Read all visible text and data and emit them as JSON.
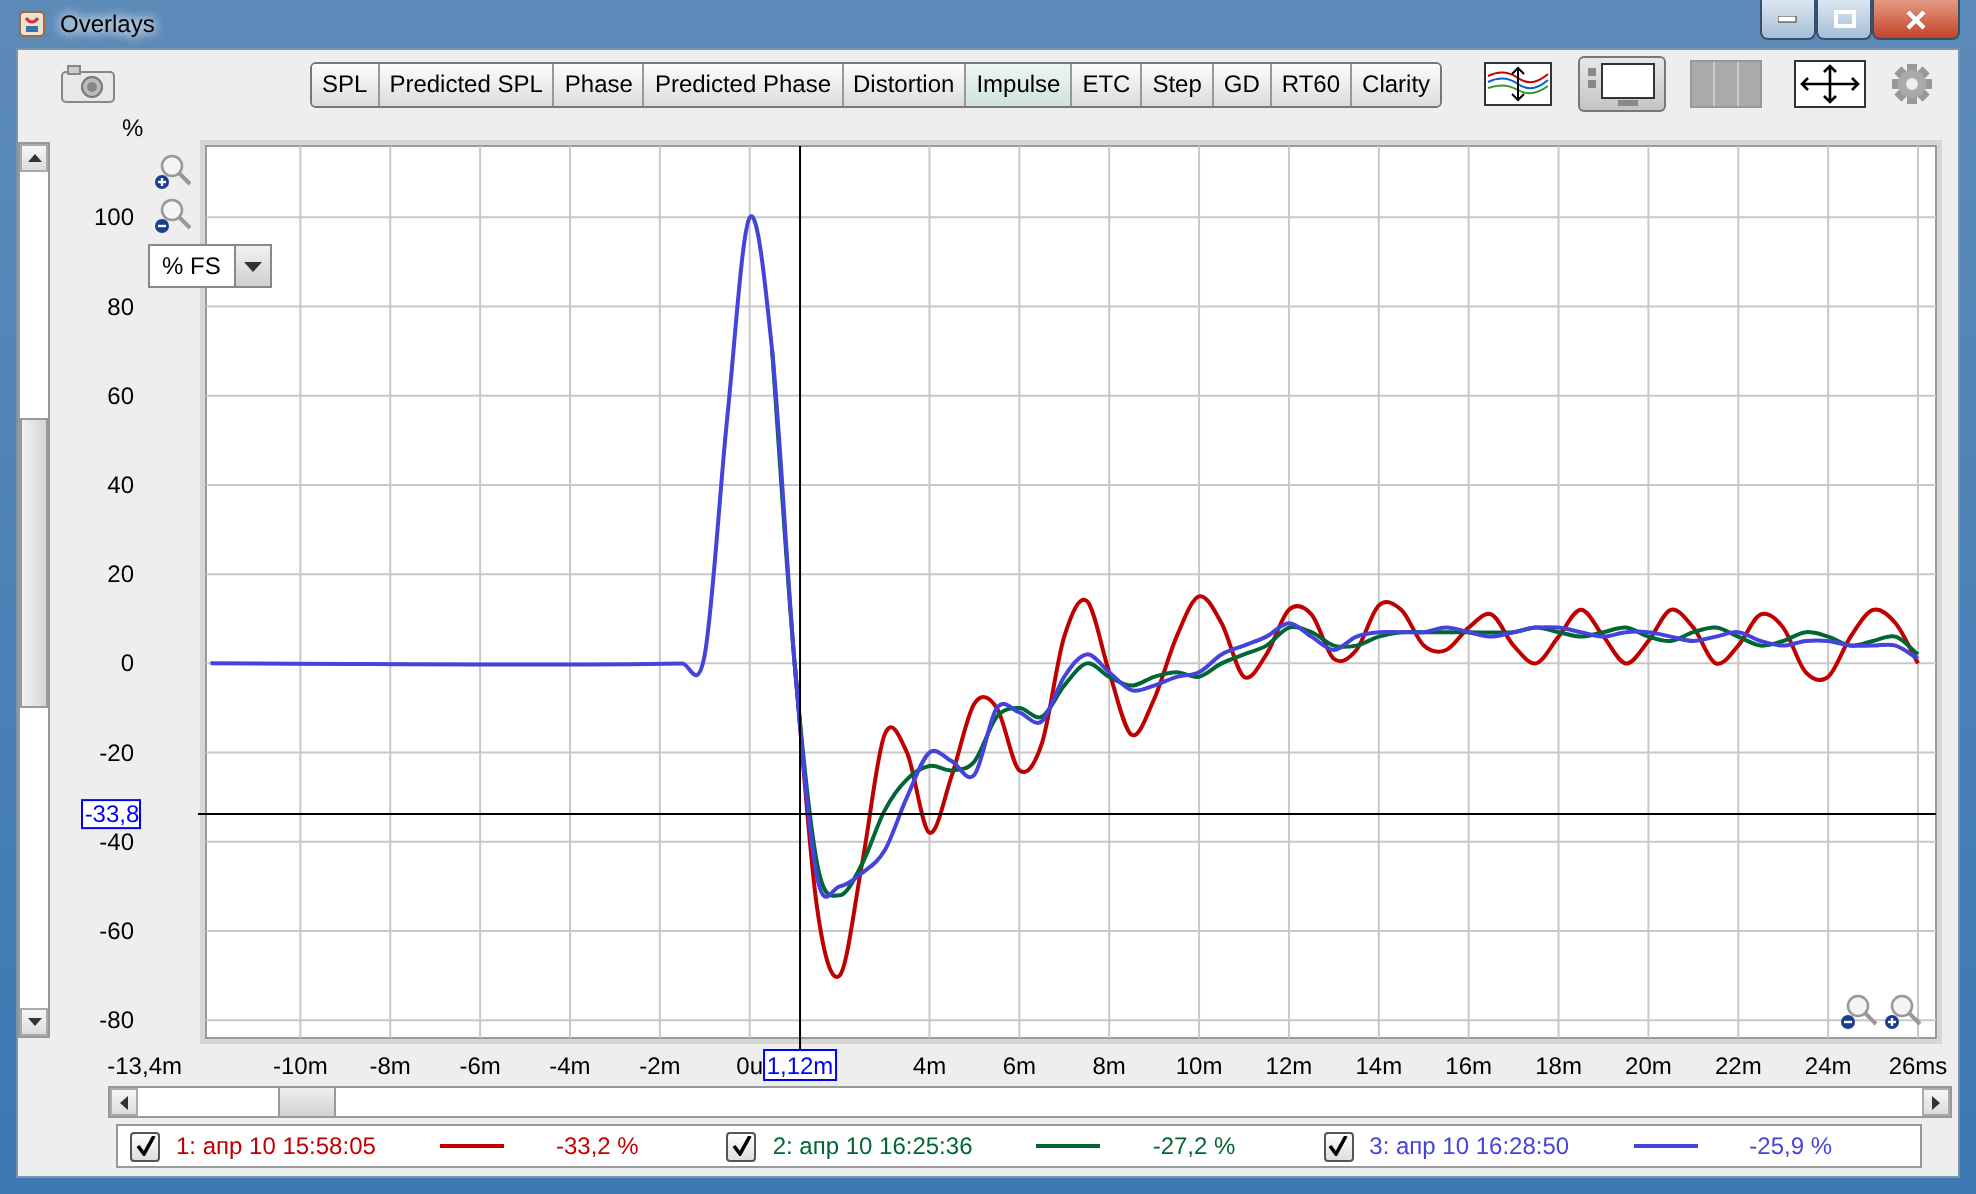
{
  "window": {
    "title": "Overlays"
  },
  "tabs": [
    {
      "label": "SPL",
      "selected": false
    },
    {
      "label": "Predicted SPL",
      "selected": false
    },
    {
      "label": "Phase",
      "selected": false
    },
    {
      "label": "Predicted Phase",
      "selected": false
    },
    {
      "label": "Distortion",
      "selected": false
    },
    {
      "label": "Impulse",
      "selected": true
    },
    {
      "label": "ETC",
      "selected": false
    },
    {
      "label": "Step",
      "selected": false
    },
    {
      "label": "GD",
      "selected": false
    },
    {
      "label": "RT60",
      "selected": false
    },
    {
      "label": "Clarity",
      "selected": false
    }
  ],
  "view_buttons": [
    {
      "kind": "traces",
      "on": false
    },
    {
      "kind": "panel",
      "on": true
    },
    {
      "kind": "columns",
      "on": false
    },
    {
      "kind": "fit",
      "on": false
    }
  ],
  "plot": {
    "y_unit": "%",
    "scale_select": {
      "value": "% FS"
    },
    "x_axis_start": "-13,4m",
    "cursor": {
      "y_readout": "-33,8",
      "x_readout": "1,12m"
    },
    "chart_data": {
      "type": "line",
      "xlim": [
        -12.1,
        26.4
      ],
      "ylim": [
        -84,
        116
      ],
      "xticks": [
        {
          "value": -10,
          "label": "-10m"
        },
        {
          "value": -8,
          "label": "-8m"
        },
        {
          "value": -6,
          "label": "-6m"
        },
        {
          "value": -4,
          "label": "-4m"
        },
        {
          "value": -2,
          "label": "-2m"
        },
        {
          "value": 0,
          "label": "0u"
        },
        {
          "value": 4,
          "label": "4m"
        },
        {
          "value": 6,
          "label": "6m"
        },
        {
          "value": 8,
          "label": "8m"
        },
        {
          "value": 10,
          "label": "10m"
        },
        {
          "value": 12,
          "label": "12m"
        },
        {
          "value": 14,
          "label": "14m"
        },
        {
          "value": 16,
          "label": "16m"
        },
        {
          "value": 18,
          "label": "18m"
        },
        {
          "value": 20,
          "label": "20m"
        },
        {
          "value": 22,
          "label": "22m"
        },
        {
          "value": 24,
          "label": "24m"
        },
        {
          "value": 26,
          "label": "26ms"
        }
      ],
      "yticks": [
        -80,
        -60,
        -40,
        -20,
        0,
        20,
        40,
        60,
        80,
        100
      ],
      "grid": true,
      "ref_lines": [
        {
          "axis": "x",
          "value": 1.12
        },
        {
          "axis": "y",
          "value": -33.8
        }
      ],
      "x": [
        -12,
        -1.5,
        -1,
        -0.5,
        0,
        0.5,
        1,
        1.5,
        2,
        2.5,
        3,
        3.5,
        4,
        4.5,
        5,
        5.5,
        6,
        6.5,
        7,
        7.5,
        8,
        8.5,
        9,
        9.5,
        10,
        10.5,
        11,
        11.5,
        12,
        12.5,
        13,
        13.5,
        14,
        14.5,
        15,
        15.5,
        16,
        16.5,
        17,
        17.5,
        18,
        18.5,
        19,
        19.5,
        20,
        20.5,
        21,
        21.5,
        22,
        22.5,
        23,
        23.5,
        24,
        24.5,
        25,
        25.5,
        26
      ],
      "series": [
        {
          "name": "1: апр 10 15:58:05",
          "color": "#c00000",
          "values": [
            null,
            null,
            null,
            null,
            null,
            null,
            0,
            -55,
            -70,
            -45,
            -16,
            -20,
            -38,
            -25,
            -9,
            -10,
            -24,
            -18,
            6,
            14,
            -2,
            -16,
            -8,
            6,
            15,
            9,
            -3,
            2,
            12,
            11,
            1,
            3,
            13,
            12,
            4,
            3,
            8,
            11,
            4,
            0,
            6,
            12,
            6,
            0,
            5,
            12,
            8,
            0,
            4,
            11,
            8,
            -2,
            -3,
            6,
            12,
            9,
            0
          ]
        },
        {
          "name": "2: апр 10 16:25:36",
          "color": "#006633",
          "values": [
            null,
            null,
            null,
            null,
            null,
            70,
            0,
            -45,
            -52,
            -45,
            -33,
            -26,
            -23,
            -24,
            -22,
            -12,
            -10,
            -12,
            -5,
            0,
            -3,
            -5,
            -3,
            -2,
            -3,
            0,
            2,
            4,
            8,
            7,
            4,
            4,
            6,
            7,
            7,
            null,
            7,
            null,
            7,
            8,
            7,
            6,
            7,
            8,
            6,
            5,
            7,
            8,
            6,
            4,
            5,
            7,
            6,
            4,
            5,
            6,
            2
          ]
        },
        {
          "name": "3: апр 10 16:28:50",
          "color": "#4444dd",
          "values": [
            0,
            0,
            2,
            55,
            100,
            70,
            0,
            -48,
            -50,
            -47,
            -42,
            -30,
            -20,
            -22,
            -25,
            -10,
            -11,
            -13,
            -3,
            2,
            -2,
            -6,
            -5,
            -3,
            -2,
            2,
            4,
            6,
            9,
            6,
            3,
            6,
            7,
            7,
            7,
            8,
            7,
            6,
            7,
            8,
            8,
            7,
            6,
            7,
            7,
            6,
            5,
            6,
            7,
            5,
            4,
            5,
            5,
            4,
            4,
            4,
            1
          ]
        }
      ]
    }
  },
  "legend": [
    {
      "checked": true,
      "value": "-33,2 %"
    },
    {
      "checked": true,
      "value": "-27,2 %"
    },
    {
      "checked": true,
      "value": "-25,9 %"
    }
  ]
}
